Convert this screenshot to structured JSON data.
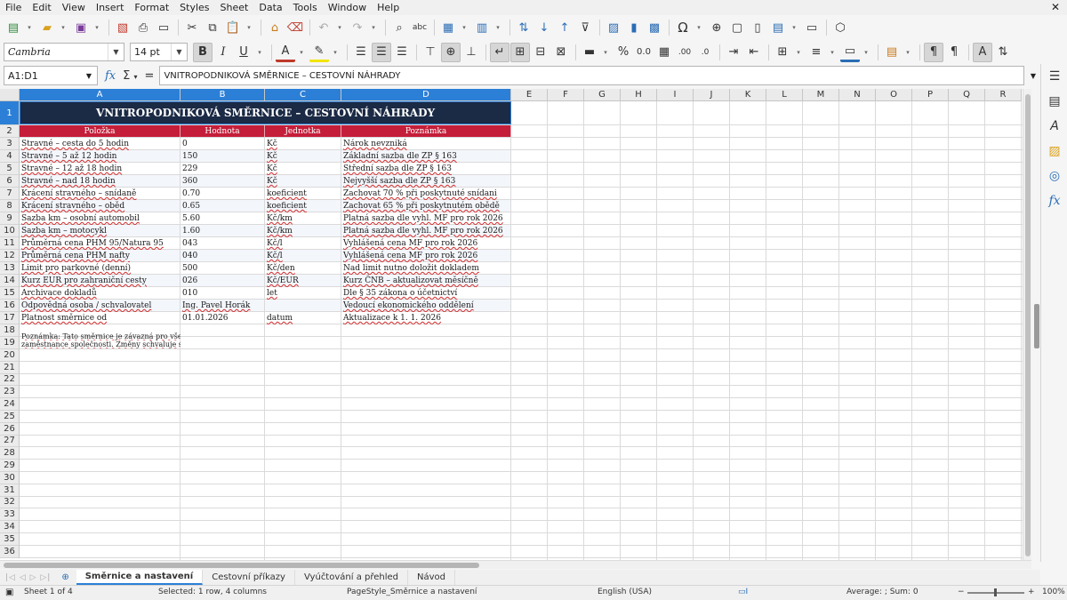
{
  "menu": [
    "File",
    "Edit",
    "View",
    "Insert",
    "Format",
    "Styles",
    "Sheet",
    "Data",
    "Tools",
    "Window",
    "Help"
  ],
  "window_close": "✕",
  "toolbar2": {
    "font_name": "Cambria",
    "font_size": "14 pt"
  },
  "formula": {
    "cell_ref": "A1:D1",
    "content": "VNITROPODNIKOVÁ SMĚRNICE – CESTOVNÍ NÁHRADY"
  },
  "columns": [
    "A",
    "B",
    "C",
    "D",
    "E",
    "F",
    "G",
    "H",
    "I",
    "J",
    "K",
    "L",
    "M",
    "N",
    "O",
    "P",
    "Q",
    "R"
  ],
  "rows": [
    "1",
    "2",
    "3",
    "4",
    "5",
    "6",
    "7",
    "8",
    "9",
    "10",
    "11",
    "12",
    "13",
    "14",
    "15",
    "16",
    "17",
    "18",
    "19",
    "20",
    "21",
    "22",
    "23",
    "24",
    "25",
    "26",
    "27",
    "28",
    "29",
    "30",
    "31",
    "32",
    "33",
    "34",
    "35",
    "36"
  ],
  "sheet": {
    "title": "VNITROPODNIKOVÁ SMĚRNICE – CESTOVNÍ NÁHRADY",
    "headers": [
      "Položka",
      "Hodnota",
      "Jednotka",
      "Poznámka"
    ],
    "data": [
      [
        "Stravné – cesta do 5 hodin",
        "0",
        "Kč",
        "Nárok nevzniká"
      ],
      [
        "Stravné – 5 až 12 hodin",
        "150",
        "Kč",
        "Základní sazba dle ZP § 163"
      ],
      [
        "Stravné – 12 až 18 hodin",
        "229",
        "Kč",
        "Střední sazba dle ZP § 163"
      ],
      [
        "Stravné – nad 18 hodin",
        "360",
        "Kč",
        "Nejvyšší sazba dle ZP § 163"
      ],
      [
        "Krácení stravného – snídaně",
        "0.70",
        "koeficient",
        "Zachovat 70 % při poskytnuté snídani"
      ],
      [
        "Krácení stravného – oběd",
        "0.65",
        "koeficient",
        "Zachovat 65 % při poskytnutém obědě"
      ],
      [
        "Sazba km – osobní automobil",
        "5.60",
        "Kč/km",
        "Platná sazba dle vyhl. MF pro rok 2026"
      ],
      [
        "Sazba km – motocykl",
        "1.60",
        "Kč/km",
        "Platná sazba dle vyhl. MF pro rok 2026"
      ],
      [
        "Průměrná cena PHM 95/Natura 95",
        "043",
        "Kč/l",
        "Vyhlášená cena MF pro rok 2026"
      ],
      [
        "Průměrná cena PHM nafty",
        "040",
        "Kč/l",
        "Vyhlášená cena MF pro rok 2026"
      ],
      [
        "Limit pro parkovné (denní)",
        "500",
        "Kč/den",
        "Nad limit nutno doložit dokladem"
      ],
      [
        "Kurz EUR pro zahraniční cesty",
        "026",
        "Kč/EUR",
        "Kurz ČNB – aktualizovat měsíčně"
      ],
      [
        "Archivace dokladů",
        "010",
        "let",
        "Dle § 35 zákona o účetnictví"
      ],
      [
        "Odpovědná osoba / schvalovatel",
        "Ing. Pavel Horák",
        "",
        "Vedoucí ekonomického oddělení"
      ],
      [
        "Platnost směrnice od",
        "01.01.2026",
        "datum",
        "Aktualizace k 1. 1. 2026"
      ]
    ],
    "row19_line1": "Poznámka: Tato směrnice je závazná pro všechny",
    "row19_line2": "zaměstnance společnosti. Změny schvaluje statutární"
  },
  "tabs": [
    "Směrnice a nastavení",
    "Cestovní příkazy",
    "Vyúčtování a přehled",
    "Návod"
  ],
  "tab_nav": "|◁ ◁ ▷ ▷|",
  "status": {
    "sheet": "Sheet 1 of 4",
    "selection": "Selected: 1 row, 4 columns",
    "page_style": "PageStyle_Směrnice a nastavení",
    "language": "English (USA)",
    "sum": "Average: ; Sum: 0",
    "zoom": "100%",
    "zoom_minus": "−",
    "zoom_plus": "+"
  },
  "colors": {
    "title_bg": "#1b2a45",
    "header_bg": "#c41e3a",
    "selection": "#2c7fd6"
  }
}
